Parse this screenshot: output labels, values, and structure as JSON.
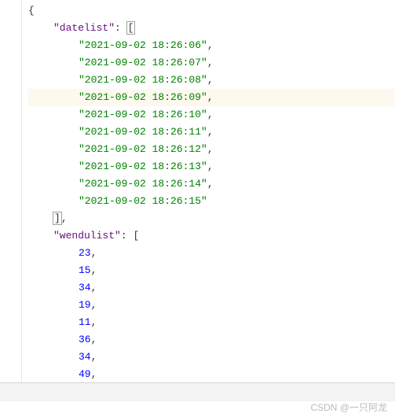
{
  "lineNumbers": [
    "",
    "",
    "",
    "",
    "",
    "",
    "",
    "",
    "",
    "",
    "",
    "",
    "",
    "",
    "",
    "",
    "",
    "",
    "",
    "",
    "",
    ""
  ],
  "code": {
    "openBrace": "{",
    "key1": "\"datelist\"",
    "datelist": [
      "\"2021-09-02 18:26:06\"",
      "\"2021-09-02 18:26:07\"",
      "\"2021-09-02 18:26:08\"",
      "\"2021-09-02 18:26:09\"",
      "\"2021-09-02 18:26:10\"",
      "\"2021-09-02 18:26:11\"",
      "\"2021-09-02 18:26:12\"",
      "\"2021-09-02 18:26:13\"",
      "\"2021-09-02 18:26:14\"",
      "\"2021-09-02 18:26:15\""
    ],
    "closeDatelist": "]",
    "key2": "\"wendulist\"",
    "wendulist": [
      "23",
      "15",
      "34",
      "19",
      "11",
      "36",
      "34",
      "49"
    ],
    "colon": ": ",
    "openBracket": "[",
    "comma": ","
  },
  "watermark": "CSDN @一只阿龙",
  "bottombar": " "
}
